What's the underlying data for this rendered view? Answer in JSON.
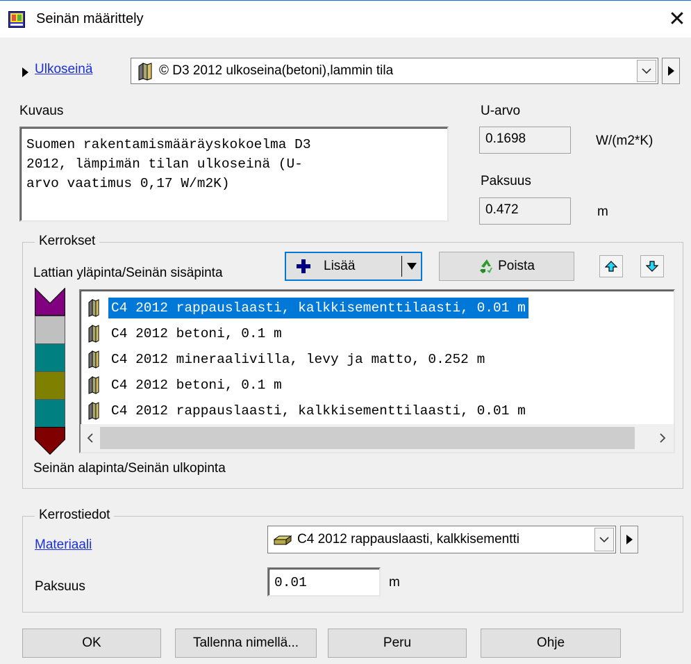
{
  "dialog": {
    "title": "Seinän määrittely",
    "close_glyph": "✕"
  },
  "wall_type": {
    "link_label": "Ulkoseinä",
    "selected": "© D3 2012 ulkoseina(betoni),lammin tila"
  },
  "description": {
    "label": "Kuvaus",
    "text": "Suomen rakentamismääräyskokoelma D3\n2012, lämpimän tilan ulkoseinä (U-\narvo vaatimus 0,17 W/m2K)"
  },
  "u_value": {
    "label": "U-arvo",
    "value": "0.1698",
    "unit": "W/(m2*K)"
  },
  "thickness": {
    "label": "Paksuus",
    "value": "0.472",
    "unit": "m"
  },
  "layers": {
    "group_label": "Kerrokset",
    "top_label": "Lattian yläpinta/Seinän sisäpinta",
    "bottom_label": "Seinän alapinta/Seinän ulkopinta",
    "add_label": "Lisää",
    "remove_label": "Poista",
    "items": [
      "C4 2012 rappauslaasti, kalkkisementtilaasti, 0.01 m",
      "C4 2012 betoni, 0.1 m",
      "C4 2012 mineraalivilla, levy ja matto, 0.252 m",
      "C4 2012 betoni, 0.1 m",
      "C4 2012 rappauslaasti, kalkkisementtilaasti, 0.01 m"
    ],
    "selected_index": 0,
    "stack_colors": [
      "#800080",
      "#c0c0c0",
      "#008080",
      "#808000",
      "#008080",
      "#800000"
    ]
  },
  "layer_details": {
    "group_label": "Kerrostiedot",
    "material_link": "Materiaali",
    "material_value": "C4 2012 rappauslaasti, kalkkisementti",
    "thickness_label": "Paksuus",
    "thickness_value": "0.01",
    "thickness_unit": "m"
  },
  "buttons": {
    "ok": "OK",
    "save_as": "Tallenna nimellä...",
    "cancel": "Peru",
    "help": "Ohje"
  },
  "colors": {
    "selection": "#0078d7",
    "link": "#1a2fd9",
    "focus": "#0078d7"
  }
}
